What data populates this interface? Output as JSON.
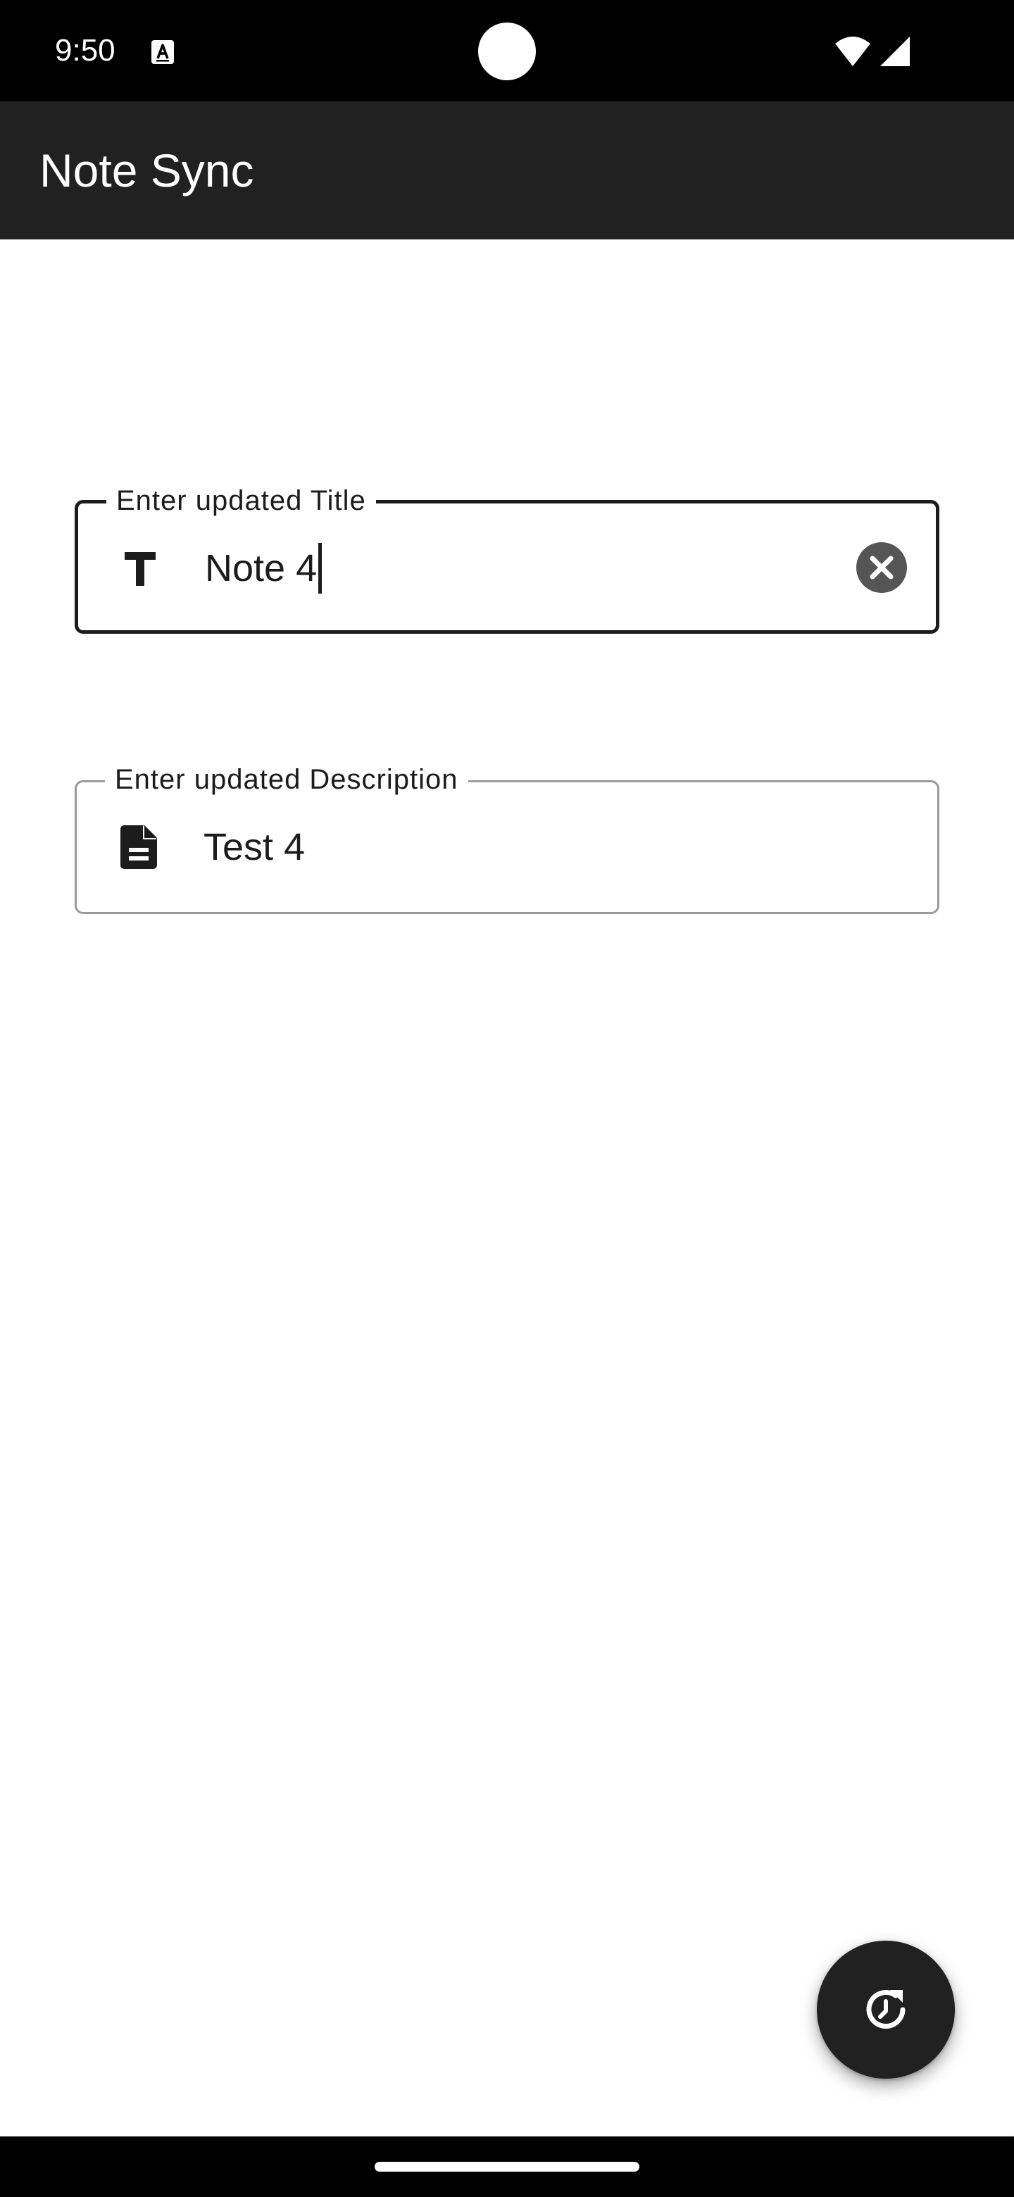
{
  "status_bar": {
    "time": "9:50",
    "notification_icon": "autofill-a-icon",
    "wifi_icon": "wifi-icon",
    "signal_icon": "cell-signal-icon"
  },
  "app_bar": {
    "title": "Note Sync"
  },
  "form": {
    "title_field": {
      "label": "Enter updated Title",
      "value": "Note 4",
      "icon": "title-text-icon",
      "clear_icon": "clear-icon",
      "focused": true
    },
    "description_field": {
      "label": "Enter updated Description",
      "value": "Test 4",
      "icon": "document-icon"
    }
  },
  "fab": {
    "icon": "update-icon"
  },
  "colors": {
    "app_bar": "#212121",
    "background": "#ffffff",
    "text": "#1c1c1c",
    "outline_focused": "#1c1c1c",
    "outline_default": "#9a9a9a",
    "fab": "#212121"
  }
}
